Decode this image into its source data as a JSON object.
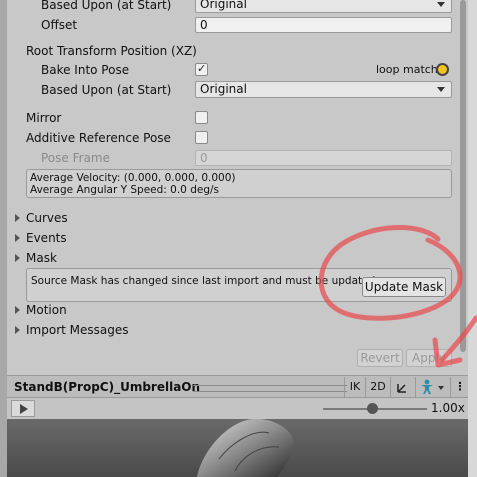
{
  "top_based_upon": {
    "label": "Based Upon (at Start)",
    "value": "Original"
  },
  "offset": {
    "label": "Offset",
    "value": "0"
  },
  "root_transform_position": {
    "title": "Root Transform Position (XZ)",
    "bake_into_pose": {
      "label": "Bake Into Pose",
      "checked": true
    },
    "loop_match": "loop match",
    "based_upon": {
      "label": "Based Upon (at Start)",
      "value": "Original"
    }
  },
  "mirror": {
    "label": "Mirror",
    "checked": false
  },
  "additive_reference_pose": {
    "label": "Additive Reference Pose",
    "checked": false
  },
  "pose_frame": {
    "label": "Pose Frame",
    "value": "0"
  },
  "info": {
    "line1": "Average Velocity: (0.000, 0.000, 0.000)",
    "line2": "Average Angular Y Speed: 0.0 deg/s"
  },
  "foldouts": {
    "curves": "Curves",
    "events": "Events",
    "mask": "Mask"
  },
  "mask_warning": "Source Mask has changed since last import and must be updated.",
  "update_mask_button": "Update Mask",
  "foldouts2": {
    "motion": "Motion",
    "import_messages": "Import Messages"
  },
  "revert_button": "Revert",
  "apply_button": "Apply",
  "preview": {
    "title": "StandB(PropC)_UmbrellaOn",
    "ik": "IK",
    "two_d": "2D",
    "speed": "1.00x"
  },
  "annotation_color": "#e8474b",
  "indicator_color": "#f2c418"
}
